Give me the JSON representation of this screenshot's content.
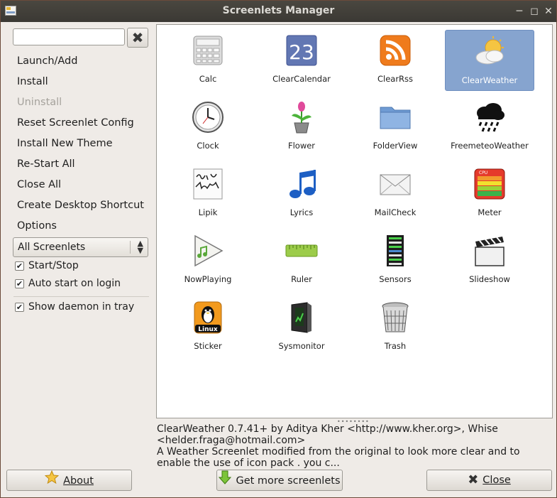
{
  "window": {
    "title": "Screenlets Manager"
  },
  "sidebar": {
    "search": {
      "value": ""
    },
    "items": [
      {
        "label": "Launch/Add",
        "enabled": true
      },
      {
        "label": "Install",
        "enabled": true
      },
      {
        "label": "Uninstall",
        "enabled": false
      },
      {
        "label": "Reset Screenlet Config",
        "enabled": true
      },
      {
        "label": "Install New Theme",
        "enabled": true
      },
      {
        "label": "Re-Start All",
        "enabled": true
      },
      {
        "label": "Close All",
        "enabled": true
      },
      {
        "label": "Create Desktop Shortcut",
        "enabled": true
      },
      {
        "label": "Options",
        "enabled": true
      }
    ],
    "filter": {
      "selected": "All Screenlets"
    },
    "checks": [
      {
        "label": "Start/Stop",
        "checked": true
      },
      {
        "label": "Auto start on login",
        "checked": true
      },
      {
        "label": "Show daemon in tray",
        "checked": true
      }
    ]
  },
  "screenlets": [
    {
      "name": "Calc",
      "icon": "calculator-icon"
    },
    {
      "name": "ClearCalendar",
      "icon": "calendar-icon",
      "icon_text": "23"
    },
    {
      "name": "ClearRss",
      "icon": "rss-icon"
    },
    {
      "name": "ClearWeather",
      "icon": "weather-icon",
      "selected": true
    },
    {
      "name": "Clock",
      "icon": "clock-icon"
    },
    {
      "name": "Flower",
      "icon": "flower-icon"
    },
    {
      "name": "FolderView",
      "icon": "folder-icon"
    },
    {
      "name": "FreemeteoWeather",
      "icon": "rain-cloud-icon"
    },
    {
      "name": "Lipik",
      "icon": "handwriting-icon"
    },
    {
      "name": "Lyrics",
      "icon": "music-note-icon"
    },
    {
      "name": "MailCheck",
      "icon": "envelope-icon"
    },
    {
      "name": "Meter",
      "icon": "cpu-meter-icon",
      "icon_text": "CPU"
    },
    {
      "name": "NowPlaying",
      "icon": "play-icon"
    },
    {
      "name": "Ruler",
      "icon": "ruler-icon"
    },
    {
      "name": "Sensors",
      "icon": "sensors-icon"
    },
    {
      "name": "Slideshow",
      "icon": "clapperboard-icon"
    },
    {
      "name": "Sticker",
      "icon": "linux-sticker-icon",
      "icon_text": "Linux"
    },
    {
      "name": "Sysmonitor",
      "icon": "computer-tower-icon"
    },
    {
      "name": "Trash",
      "icon": "trash-icon"
    }
  ],
  "description": {
    "line1": "ClearWeather 0.7.41+ by Aditya Kher <http://www.kher.org>, Whise",
    "line2": "<helder.fraga@hotmail.com>",
    "line3": "A Weather Screenlet modified from the original to look more clear and to",
    "line4": "enable the use of icon pack . you c..."
  },
  "buttons": {
    "about": "About",
    "more": "Get more screenlets",
    "close": "Close"
  },
  "colors": {
    "selection": "#86a4cf",
    "titlebar": "#3b3934",
    "disabled_text": "#a5a29c"
  }
}
